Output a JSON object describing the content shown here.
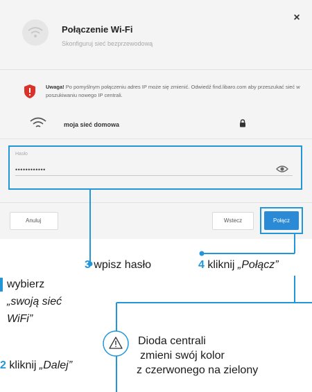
{
  "dialog": {
    "title": "Połączenie Wi-Fi",
    "subtitle": "Skonfiguruj sieć bezprzewodową",
    "close_label": "×",
    "warning_bold": "Uwaga!",
    "warning_text": " Po pomyślnym połączeniu adres IP może się zmienić. Odwiedź find.libaro.com aby przeszukać sieć w poszukiwaniu nowego IP centrali.",
    "network_name": "moja sieć domowa",
    "password_label": "Hasło",
    "password_value": "••••••••••••",
    "cancel_label": "Anuluj",
    "back_label": "Wstecz",
    "connect_label": "Połącz"
  },
  "annotations": {
    "step3_num": "3",
    "step3_text": " wpisz hasło",
    "step4_num": "4",
    "step4_text": " kliknij ",
    "step4_italic": "„Połącz”",
    "step1_text": "wybierz",
    "step1_line2": "„swoją sieć",
    "step1_line3": "WiFi”",
    "step2_num": "2",
    "step2_text": " kliknij ",
    "step2_italic": "„Dalej”",
    "note_line1": "Dioda centrali",
    "note_line2": "zmieni swój kolor",
    "note_line3": "z czerwonego na zielony"
  },
  "colors": {
    "accent": "#2296d8",
    "button": "#2a8ad6",
    "warning_shield": "#d9322b"
  }
}
